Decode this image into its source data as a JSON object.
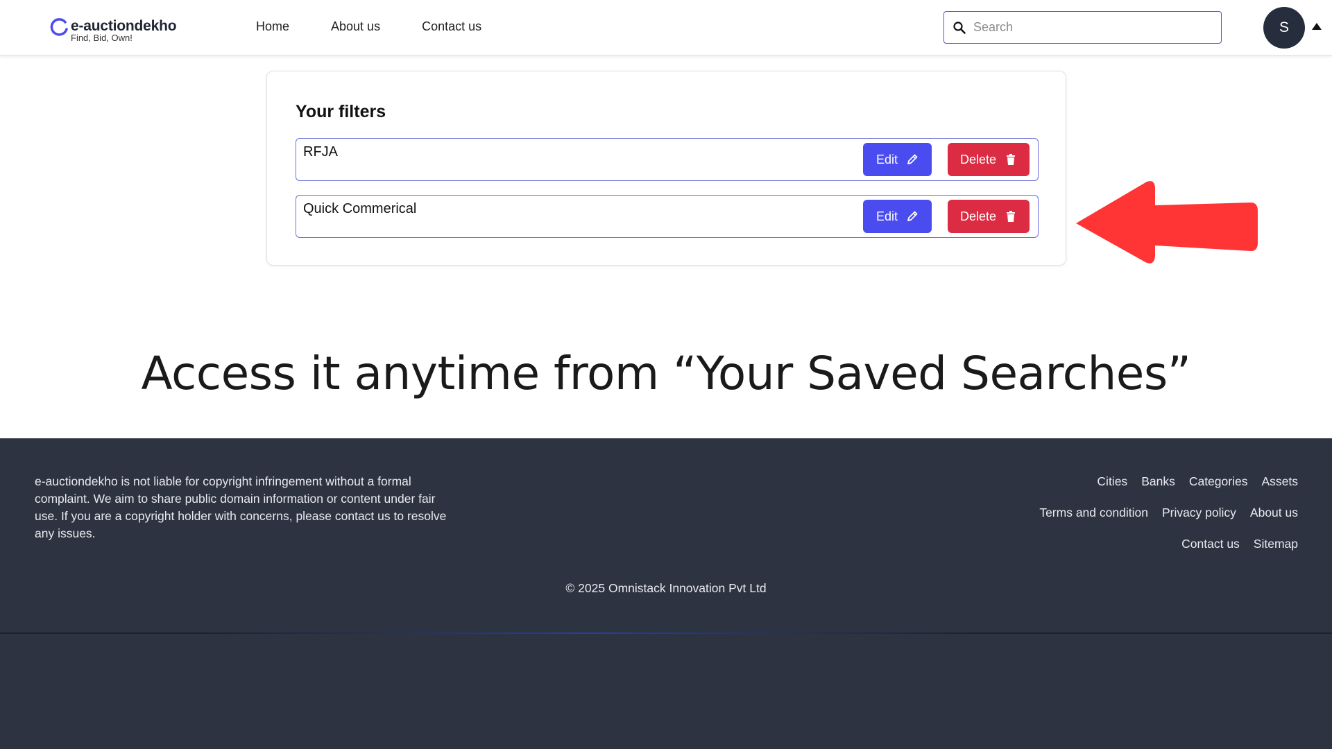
{
  "header": {
    "logo_name": "e-auctiondekho",
    "logo_tagline": "Find, Bid, Own!",
    "nav": [
      "Home",
      "About us",
      "Contact us"
    ],
    "search_placeholder": "Search",
    "avatar_initial": "S"
  },
  "filters": {
    "title": "Your filters",
    "items": [
      {
        "name": "RFJA",
        "edit_label": "Edit",
        "delete_label": "Delete"
      },
      {
        "name": "Quick Commerical",
        "edit_label": "Edit",
        "delete_label": "Delete"
      }
    ]
  },
  "caption": "Access it anytime from “Your Saved Searches”",
  "footer": {
    "disclaimer": "e-auctiondekho is not liable for copyright infringement without a formal complaint. We aim to share public domain information or content under fair use. If you are a copyright holder with concerns, please contact us to resolve any issues.",
    "links_row1": [
      "Cities",
      "Banks",
      "Categories",
      "Assets"
    ],
    "links_row2": [
      "Terms and condition",
      "Privacy policy",
      "About us"
    ],
    "links_row3": [
      "Contact us",
      "Sitemap"
    ],
    "copyright": "© 2025 Omnistack Innovation Pvt Ltd"
  },
  "colors": {
    "brand_accent": "#4a4cf0",
    "delete_red": "#db2c44",
    "footer_bg": "#2d3340",
    "arrow_red": "#ff3535"
  },
  "icons": [
    "logo-icon",
    "search-icon",
    "caret-up-icon",
    "pencil-icon",
    "trash-icon",
    "red-arrow-icon"
  ]
}
